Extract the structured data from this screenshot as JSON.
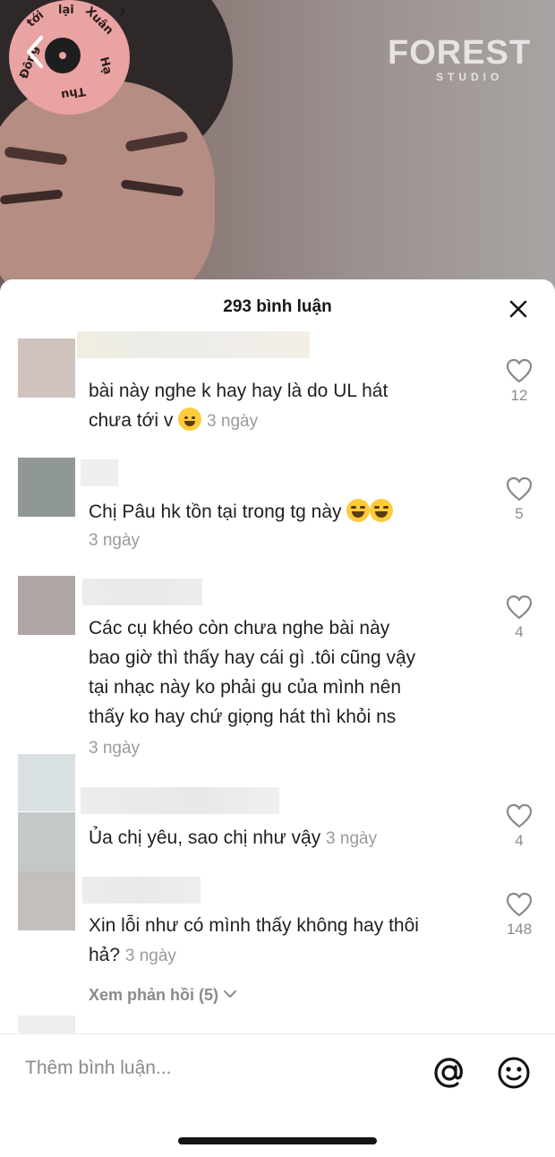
{
  "video": {
    "badge_text": [
      "Đông",
      "tới",
      "lại",
      "Xuân",
      "Hạ",
      "Thu"
    ],
    "logo": "FOREST",
    "logo_sub": "STUDIO",
    "back_icon": "chevron-left-icon"
  },
  "sheet": {
    "title": "293 bình luận",
    "close_icon": "close-icon"
  },
  "comments": [
    {
      "avatar_color": "#d0c3bd",
      "lines": [
        "bài này nghe k hay hay là do UL hát",
        "chưa tới v"
      ],
      "emoji": "sweat-smile",
      "date": "3 ngày",
      "likes": "12"
    },
    {
      "avatar_color": "#8f9896",
      "lines": [
        "Chị Pâu hk tồn tại trong tg này"
      ],
      "emoji": "laugh-tears",
      "date": "3 ngày",
      "likes": "5"
    },
    {
      "avatar_color": "#b0a6a6",
      "lines": [
        "Các cụ khéo còn chưa nghe bài này",
        "bao giờ thì thấy hay cái gì .tôi cũng vậy",
        "tại nhạc này ko phải gu của mình nên",
        "thấy ko hay chứ giọng hát thì khỏi ns"
      ],
      "date": "3 ngày",
      "likes": "4"
    },
    {
      "avatar_color": "#c4c8c9",
      "lines": [
        "Ủa chị yêu, sao chị như vậy"
      ],
      "date": "3 ngày",
      "likes": "4"
    },
    {
      "avatar_color": "#c2bfbc",
      "lines": [
        "Xin lỗi như có mình thấy không hay thôi",
        "hả?"
      ],
      "date": "3 ngày",
      "likes": "148",
      "view_replies": "Xem phản hồi (5)"
    }
  ],
  "input": {
    "placeholder": "Thêm bình luận...",
    "mention_icon": "at-icon",
    "emoji_icon": "smile-icon"
  }
}
